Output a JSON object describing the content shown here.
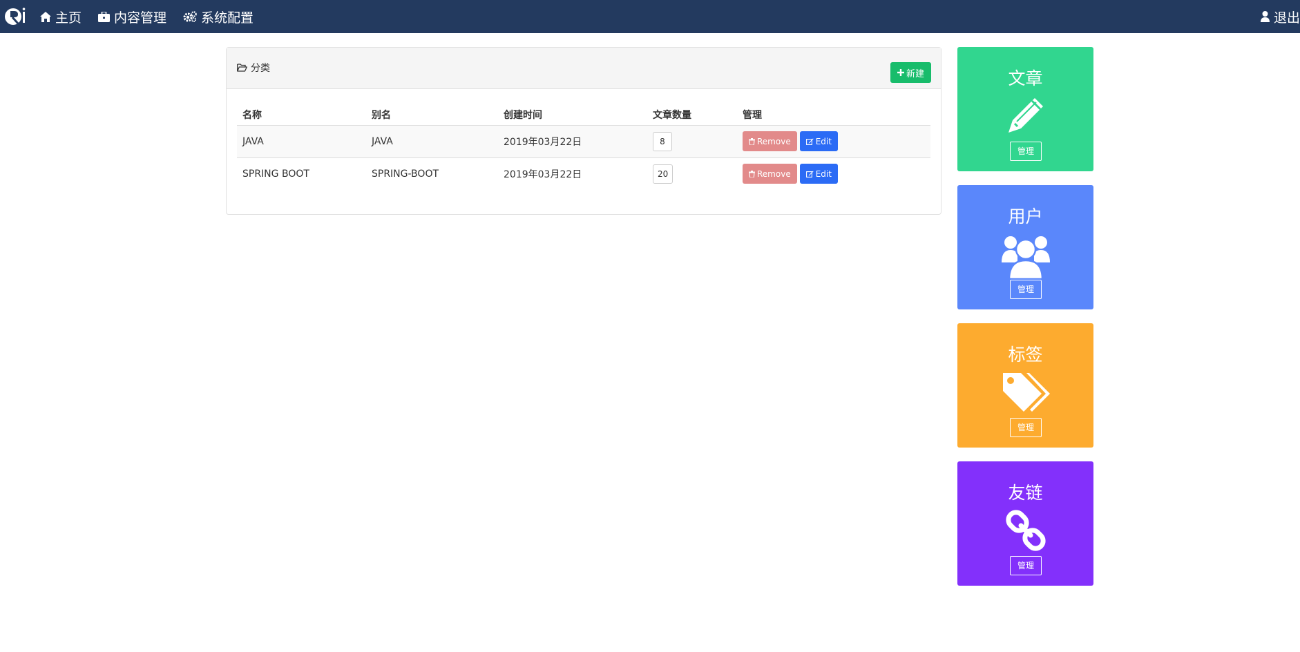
{
  "navbar": {
    "items": [
      {
        "label": "主页",
        "icon": "home-icon"
      },
      {
        "label": "内容管理",
        "icon": "briefcase-icon"
      },
      {
        "label": "系统配置",
        "icon": "cogs-icon"
      }
    ],
    "logout_label": "退出",
    "bg_color": "#233a5f"
  },
  "panel": {
    "title": "分类",
    "new_button": "新建"
  },
  "table": {
    "headers": [
      "名称",
      "别名",
      "创建时间",
      "文章数量",
      "管理"
    ],
    "rows": [
      {
        "name": "JAVA",
        "alias": "JAVA",
        "created": "2019年03月22日",
        "count": "8"
      },
      {
        "name": "SPRING BOOT",
        "alias": "SPRING-BOOT",
        "created": "2019年03月22日",
        "count": "20"
      }
    ],
    "remove_label": "Remove",
    "edit_label": "Edit"
  },
  "cards": [
    {
      "title": "文章",
      "button": "管理",
      "icon": "pencil-icon",
      "color": "#31d68f"
    },
    {
      "title": "用户",
      "button": "管理",
      "icon": "users-icon",
      "color": "#5a87fb"
    },
    {
      "title": "标签",
      "button": "管理",
      "icon": "tags-icon",
      "color": "#fdab2f"
    },
    {
      "title": "友链",
      "button": "管理",
      "icon": "link-icon",
      "color": "#8330fb"
    }
  ]
}
